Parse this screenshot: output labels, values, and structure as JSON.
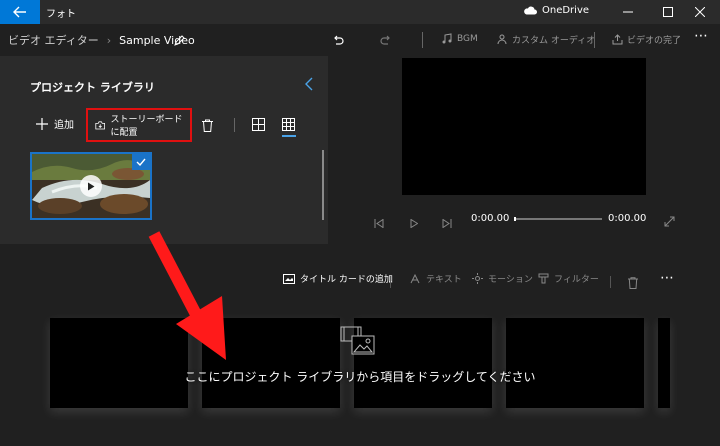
{
  "titlebar": {
    "app_title": "フォト",
    "cloud_label": "OneDrive",
    "minimize": "—",
    "maximize": "☐",
    "close": "✕"
  },
  "toolbar": {
    "breadcrumb_root": "ビデオ エディター",
    "breadcrumb_sep": "›",
    "project_name": "Sample Video",
    "bgm_label": "BGM",
    "custom_audio_label": "カスタム オーディオ",
    "finish_label": "ビデオの完了",
    "more": "⋯"
  },
  "library": {
    "title": "プロジェクト ライブラリ",
    "add_label": "追加",
    "storyboard_label": "ストーリーボードに配置"
  },
  "preview": {
    "time_current": "0:00.00",
    "time_total": "0:00.00",
    "progress": 0
  },
  "storyboard": {
    "title_card_label": "タイトル カードの追加",
    "text_label": "テキスト",
    "motion_label": "モーション",
    "filter_label": "フィルター",
    "more": "⋯",
    "drop_hint": "ここにプロジェクト ライブラリから項目をドラッグしてください"
  },
  "colors": {
    "accent": "#0078d7",
    "highlight": "#e01010",
    "selection": "#1a73c8"
  }
}
